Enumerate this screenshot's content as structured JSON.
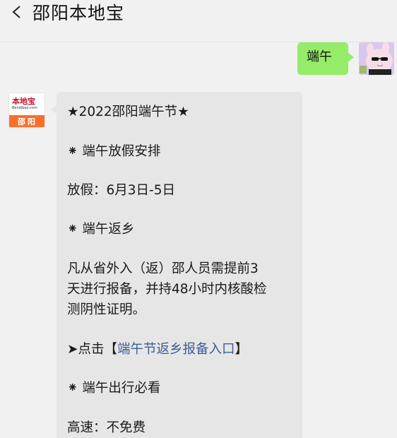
{
  "header": {
    "title": "邵阳本地宝"
  },
  "outgoing": {
    "text": "端午"
  },
  "incoming": {
    "avatar": {
      "brand": "本地宝",
      "url": "Bendibao.com",
      "city": "邵阳"
    },
    "lines": [
      "★2022邵阳端午节★",
      "⁕ 端午放假安排",
      "放假：6月3日-5日",
      "⁕ 端午返乡",
      "凡从省外入（返）邵人员需提前3",
      "天进行报备，并持48小时内核酸检",
      "测阴性证明。",
      "➤点击【",
      "端午节返乡报备入口",
      "】",
      "⁕ 端午出行必看",
      "高速：不免费"
    ]
  },
  "colors": {
    "outgoing_bubble": "#95ec69",
    "incoming_bubble": "#e6e6e6",
    "link": "#3e5d98",
    "logo_accent": "#f7702a"
  }
}
